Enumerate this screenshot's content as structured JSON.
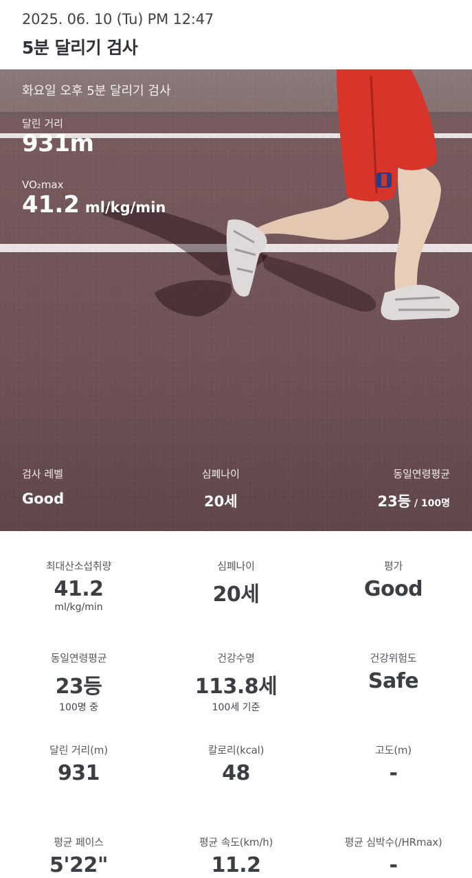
{
  "header": {
    "date": "2025. 06. 10 (Tu) PM 12:47",
    "title": "5분 달리기 검사"
  },
  "hero": {
    "subtitle": "화요일 오후 5분 달리기 검사",
    "distance_label": "달린 거리",
    "distance_value": "931m",
    "vo2_label": "VO₂max",
    "vo2_value": "41.2",
    "vo2_unit": "ml/kg/min",
    "level_label": "검사 레벨",
    "level_value": "Good",
    "fitness_age_label": "심폐나이",
    "fitness_age_value": "20세",
    "peer_rank_label": "동일연령평균",
    "peer_rank_value": "23등",
    "peer_rank_suffix": " / 100명"
  },
  "stats": {
    "row1": [
      {
        "label": "최대산소섭취량",
        "value": "41.2",
        "unit": "ml/kg/min"
      },
      {
        "label": "심폐나이",
        "value": "20세",
        "unit": ""
      },
      {
        "label": "평가",
        "value": "Good",
        "unit": ""
      }
    ],
    "row2": [
      {
        "label": "동일연령평균",
        "value": "23등",
        "unit": "100명 중"
      },
      {
        "label": "건강수명",
        "value": "113.8세",
        "unit": "100세 기준"
      },
      {
        "label": "건강위험도",
        "value": "Safe",
        "unit": ""
      }
    ],
    "row3": [
      {
        "label": "달린 거리(m)",
        "value": "931",
        "unit": ""
      },
      {
        "label": "칼로리(kcal)",
        "value": "48",
        "unit": ""
      },
      {
        "label": "고도(m)",
        "value": "-",
        "unit": ""
      }
    ],
    "row4": [
      {
        "label": "평균 페이스",
        "value": "5'22\"",
        "unit": ""
      },
      {
        "label": "평균 속도(km/h)",
        "value": "11.2",
        "unit": ""
      },
      {
        "label": "평균 심박수(/HRmax)",
        "value": "-",
        "unit": ""
      }
    ]
  },
  "colors": {
    "shorts": "#d8352a",
    "road": "#6d5155",
    "lane": "#e9e3e4",
    "text_dark": "#3b3e43"
  },
  "icons": {
    "runner_photo": "runner-legs-image"
  }
}
